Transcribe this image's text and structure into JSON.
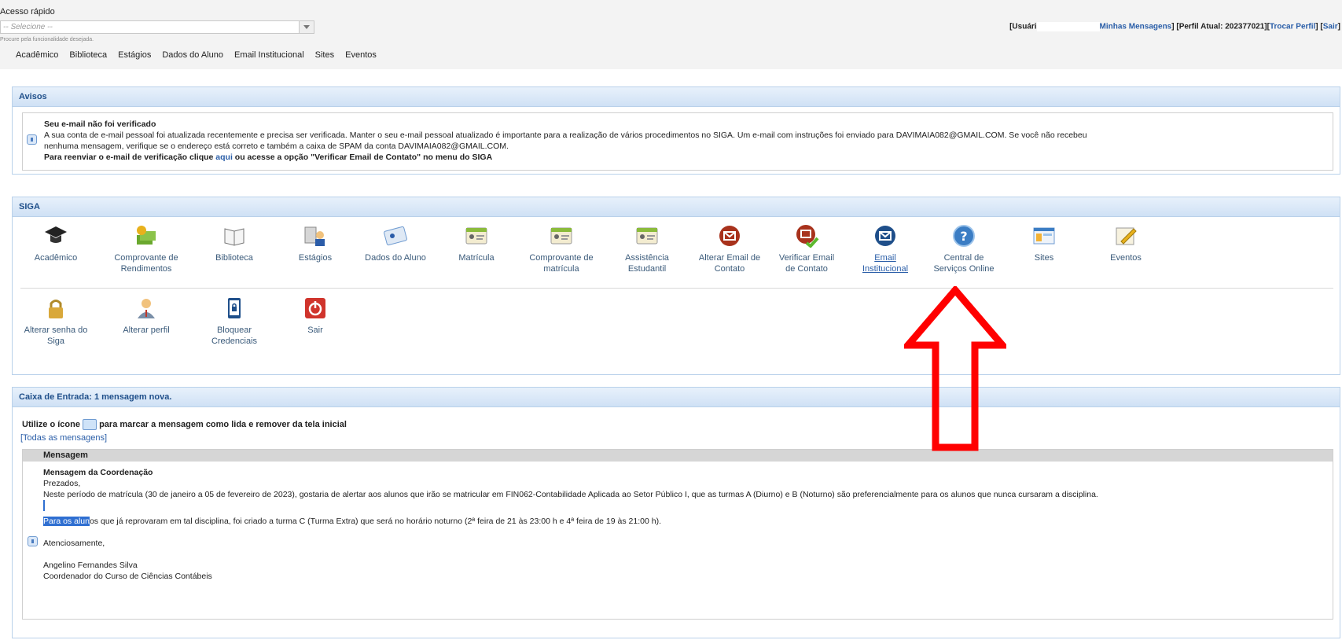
{
  "quick_access": {
    "label": "Acesso rápido",
    "select_value": "-- Selecione --",
    "hint": "Procure pela funcionalidade desejada."
  },
  "menu": [
    "Acadêmico",
    "Biblioteca",
    "Estágios",
    "Dados do Aluno",
    "Email Institucional",
    "Sites",
    "Eventos"
  ],
  "user_bar": {
    "prefix": "[Usuári",
    "messages": "Minhas Mensagens",
    "profile": "] [Perfil Atual: 202377021][",
    "change_profile": "Trocar Perfil",
    "sep": "] [",
    "logout": "Sair",
    "end": "]"
  },
  "avisos": {
    "title": "Avisos",
    "heading": "Seu e-mail não foi verificado",
    "line1": "A sua conta de e-mail pessoal foi atualizada recentemente e precisa ser verificada. Manter o seu e-mail pessoal atualizado é importante para a realização de vários procedimentos no SIGA. Um e-mail com instruções foi enviado para DAVIMAIA082@GMAIL.COM. Se você não recebeu",
    "line2": "nenhuma mensagem, verifique se o endereço está correto e também a caixa de SPAM da conta DAVIMAIA082@GMAIL.COM.",
    "line3_a": "Para reenviar o e-mail de verificação clique ",
    "line3_link": "aqui",
    "line3_b": " ou acesse a opção \"Verificar Email de Contato\" no menu do SIGA"
  },
  "siga": {
    "title": "SIGA",
    "row1": [
      {
        "l1": "Acadêmico",
        "l2": "",
        "icon": "graduation-cap-icon"
      },
      {
        "l1": "Comprovante de",
        "l2": "Rendimentos",
        "icon": "money-icon"
      },
      {
        "l1": "Biblioteca",
        "l2": "",
        "icon": "book-icon"
      },
      {
        "l1": "Estágios",
        "l2": "",
        "icon": "intern-icon"
      },
      {
        "l1": "Dados do Aluno",
        "l2": "",
        "icon": "student-card-icon"
      },
      {
        "l1": "Matrícula",
        "l2": "",
        "icon": "id-card-icon"
      },
      {
        "l1": "Comprovante de",
        "l2": "matrícula",
        "icon": "id-card-icon"
      },
      {
        "l1": "Assistência",
        "l2": "Estudantil",
        "icon": "id-card-icon"
      },
      {
        "l1": "Alterar Email de",
        "l2": "Contato",
        "icon": "email-red-icon"
      },
      {
        "l1": "Verificar Email",
        "l2": "de Contato",
        "icon": "email-check-icon"
      },
      {
        "l1": "Email",
        "l2": "Institucional",
        "icon": "email-blue-icon"
      },
      {
        "l1": "Central de",
        "l2": "Serviços Online",
        "icon": "help-icon"
      },
      {
        "l1": "Sites",
        "l2": "",
        "icon": "website-icon"
      },
      {
        "l1": "Eventos",
        "l2": "",
        "icon": "notepad-icon"
      }
    ],
    "row2": [
      {
        "l1": "Alterar senha do",
        "l2": "Siga",
        "icon": "lock-icon"
      },
      {
        "l1": "Alterar perfil",
        "l2": "",
        "icon": "user-icon"
      },
      {
        "l1": "Bloquear",
        "l2": "Credenciais",
        "icon": "phone-lock-icon"
      },
      {
        "l1": "Sair",
        "l2": "",
        "icon": "power-icon"
      }
    ]
  },
  "inbox": {
    "title": "Caixa de Entrada: 1 mensagem nova.",
    "instruction_a": "Utilize o ícone ",
    "instruction_b": " para marcar a mensagem como lida e remover da tela inicial",
    "all_messages": "[Todas as mensagens]",
    "col_header": "Mensagem",
    "msg_title": "Mensagem da Coordenação",
    "greeting": "Prezados,",
    "p1": "Neste período de matrícula (30 de janeiro a 05 de fevereiro de 2023), gostaria de alertar aos alunos que irão se matricular em FIN062-Contabilidade Aplicada ao Setor Público I, que as turmas A (Diurno) e B (Noturno) são preferencialmente para os alunos que nunca cursaram a disciplina.",
    "p2_hl": "Para os alun",
    "p2": "os que já reprovaram em tal disciplina, foi criado a turma C (Turma Extra) que será no horário noturno (2ª feira de 21 às 23:00 h e 4ª feira de 19 às 21:00 h).",
    "closing": "Atenciosamente,",
    "signer": "Angelino Fernandes Silva",
    "signer_role": "Coordenador do Curso de Ciências Contábeis"
  },
  "colors": {
    "accent_blue": "#2a5ea8",
    "panel_header": "#cfe1f5",
    "arrow_red": "#ff0000"
  }
}
